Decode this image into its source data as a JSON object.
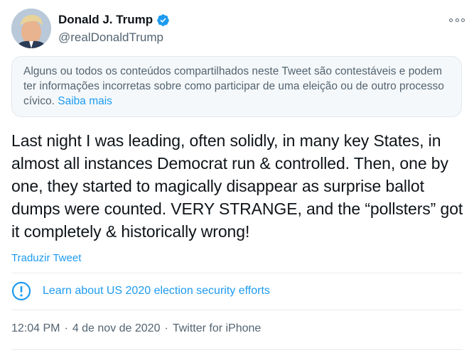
{
  "user": {
    "name": "Donald J. Trump",
    "handle": "@realDonaldTrump"
  },
  "notice": {
    "text": "Alguns ou todos os conteúdos compartilhados neste Tweet são contestáveis e podem ter informações incorretas sobre como participar de uma eleição ou de outro processo cívico.",
    "link": "Saiba mais"
  },
  "tweet": {
    "text": "Last night I was leading, often solidly, in many key States, in almost all instances Democrat run & controlled. Then, one by one, they started to magically disappear as surprise ballot dumps were counted. VERY STRANGE, and the “pollsters” got it completely & historically wrong!",
    "translate": "Traduzir Tweet"
  },
  "election_info": {
    "label": "Learn about US 2020 election security efforts",
    "icon": "exclamation-circle-icon"
  },
  "meta": {
    "time": "12:04 PM",
    "separator": "·",
    "date": "4 de nov de 2020",
    "source": "Twitter for iPhone"
  },
  "colors": {
    "accent": "#1d9bf0",
    "text": "#0f1419",
    "secondary": "#536471",
    "notice_bg": "#f5f8fa"
  }
}
